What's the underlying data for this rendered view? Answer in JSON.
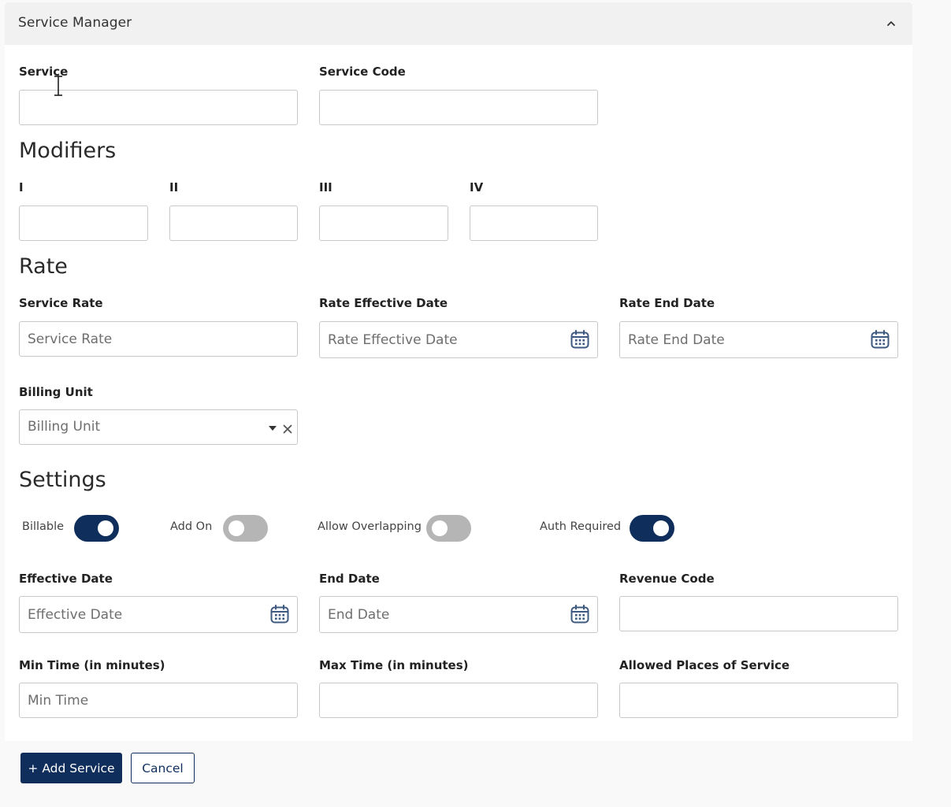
{
  "panel": {
    "title": "Service Manager"
  },
  "service": {
    "service_label": "Service",
    "service_value": "",
    "code_label": "Service Code",
    "code_value": ""
  },
  "modifiers": {
    "title": "Modifiers",
    "fields": [
      {
        "label": "I",
        "value": ""
      },
      {
        "label": "II",
        "value": ""
      },
      {
        "label": "III",
        "value": ""
      },
      {
        "label": "IV",
        "value": ""
      }
    ]
  },
  "rate": {
    "title": "Rate",
    "service_rate_label": "Service Rate",
    "service_rate_placeholder": "Service Rate",
    "effective_label": "Rate Effective Date",
    "effective_placeholder": "Rate Effective Date",
    "end_label": "Rate End Date",
    "end_placeholder": "Rate End Date",
    "billing_unit_label": "Billing Unit",
    "billing_unit_placeholder": "Billing Unit"
  },
  "settings": {
    "title": "Settings",
    "toggles": [
      {
        "label": "Billable",
        "on": true
      },
      {
        "label": "Add On",
        "on": false
      },
      {
        "label": "Allow Overlapping",
        "on": false
      },
      {
        "label": "Auth Required",
        "on": true
      }
    ],
    "effective_date_label": "Effective Date",
    "effective_date_placeholder": "Effective Date",
    "end_date_label": "End Date",
    "end_date_placeholder": "End Date",
    "revenue_code_label": "Revenue Code",
    "revenue_code_value": "",
    "min_time_label": "Min Time (in minutes)",
    "min_time_placeholder": "Min Time",
    "max_time_label": "Max Time (in minutes)",
    "max_time_value": "",
    "allowed_places_label": "Allowed Places of Service",
    "allowed_places_value": ""
  },
  "actions": {
    "add_label": "+ Add Service",
    "cancel_label": "Cancel"
  },
  "colors": {
    "primary": "#0f2e5c",
    "toggle_off": "#b5b5b5",
    "header_bg": "#f1f1f1",
    "icon": "#3e5a80"
  },
  "icons": {
    "collapse": "chevron-up-icon",
    "date": "calendar-icon",
    "dropdown": "caret-down-icon",
    "clear": "close-icon"
  }
}
